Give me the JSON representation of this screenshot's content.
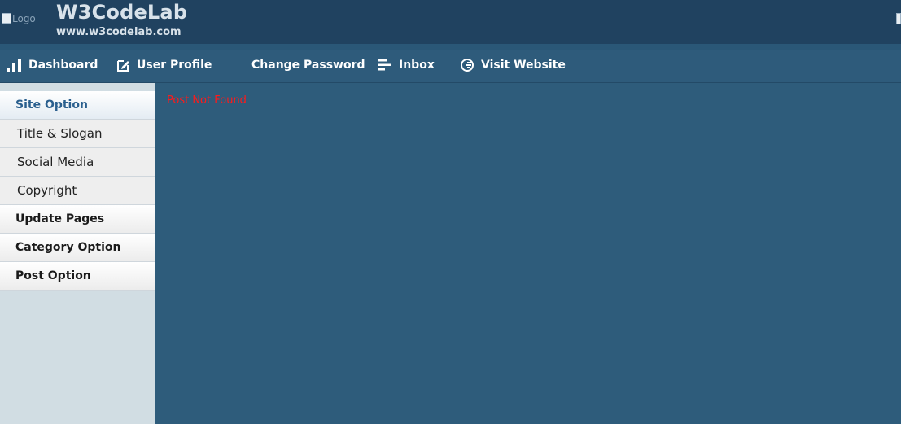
{
  "header": {
    "logo_alt": "Logo",
    "title": "W3CodeLab",
    "url": "www.w3codelab.com"
  },
  "nav": {
    "dashboard": "Dashboard",
    "user_profile": "User Profile",
    "change_password": "Change Password",
    "inbox": "Inbox",
    "visit_website": "Visit Website"
  },
  "sidebar": {
    "site_option": "Site Option",
    "title_slogan": "Title & Slogan",
    "social_media": "Social Media",
    "copyright": "Copyright",
    "update_pages": "Update Pages",
    "category_option": "Category Option",
    "post_option": "Post Option"
  },
  "main": {
    "message": "Post Not Found"
  },
  "colors": {
    "header_bg": "#204260",
    "nav_bg": "#2e5b7b",
    "content_bg": "#2e5c7b",
    "sidebar_bg": "#d1dde3",
    "active_text": "#2a5f8e",
    "error_text": "#ff1a1a"
  }
}
